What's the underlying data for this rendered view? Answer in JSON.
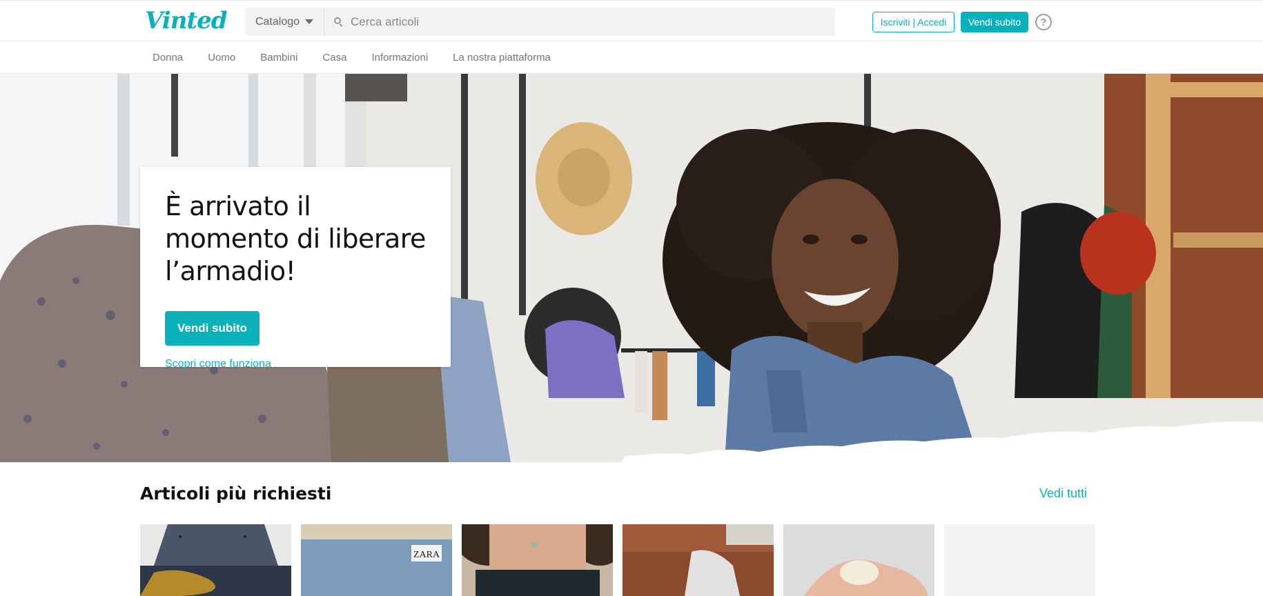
{
  "header": {
    "logo": "Vinted",
    "catalog_label": "Catalogo",
    "search_placeholder": "Cerca articoli",
    "login_label": "Iscriviti | Accedi",
    "sell_label": "Vendi subito",
    "help_symbol": "?"
  },
  "nav": {
    "items": [
      {
        "label": "Donna"
      },
      {
        "label": "Uomo"
      },
      {
        "label": "Bambini"
      },
      {
        "label": "Casa"
      },
      {
        "label": "Informazioni"
      },
      {
        "label": "La nostra piattaforma"
      }
    ]
  },
  "hero": {
    "title": "È arrivato il momento di liberare l’armadio!",
    "sell_button": "Vendi subito",
    "how_link": "Scopri come funziona"
  },
  "popular": {
    "title": "Articoli più richiesti",
    "see_all": "Vedi tutti",
    "brand_tag": "ZARA"
  },
  "colors": {
    "brand": "#09b1ba",
    "text": "#171717",
    "muted": "#757575"
  }
}
